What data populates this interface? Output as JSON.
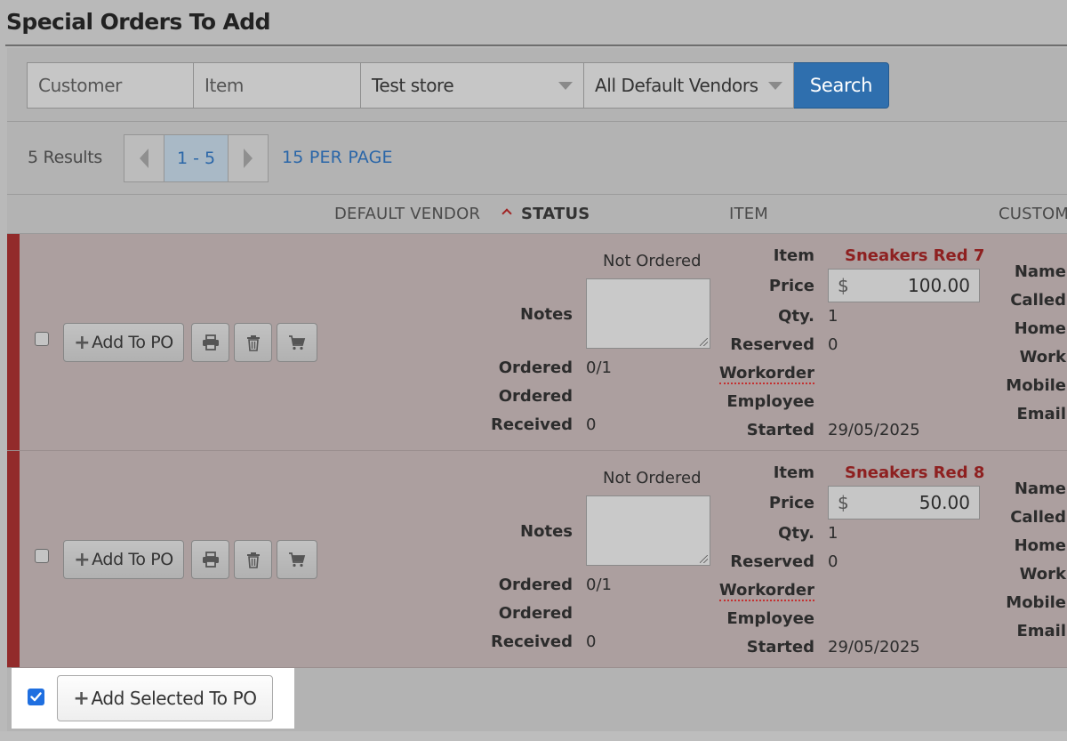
{
  "page": {
    "title": "Special Orders To Add"
  },
  "search": {
    "customer_placeholder": "Customer",
    "item_placeholder": "Item",
    "store_selected": "Test store",
    "vendor_selected": "All Default Vendors",
    "search_label": "Search"
  },
  "pagination": {
    "results": "5 Results",
    "current_range": "1 - 5",
    "per_page": "15 PER PAGE"
  },
  "columns": {
    "default_vendor": "DEFAULT VENDOR",
    "status": "STATUS",
    "item": "ITEM",
    "customer": "CUSTOM"
  },
  "labels": {
    "add_to_po": "Add To PO",
    "notes": "Notes",
    "ordered": "Ordered",
    "received": "Received",
    "item": "Item",
    "price": "Price",
    "qty": "Qty.",
    "reserved": "Reserved",
    "workorder": "Workorder",
    "employee": "Employee",
    "started": "Started",
    "currency": "$",
    "name": "Name",
    "called": "Called",
    "home": "Home",
    "work": "Work",
    "mobile": "Mobile",
    "email": "Email"
  },
  "rows": [
    {
      "status": "Not Ordered",
      "ordered_count": "0/1",
      "received": "0",
      "item_name": "Sneakers Red 7",
      "price": "100.00",
      "qty": "1",
      "reserved": "0",
      "started": "29/05/2025"
    },
    {
      "status": "Not Ordered",
      "ordered_count": "0/1",
      "received": "0",
      "item_name": "Sneakers Red 8",
      "price": "50.00",
      "qty": "1",
      "reserved": "0",
      "started": "29/05/2025"
    }
  ],
  "footer": {
    "add_selected_label": "Add Selected To PO"
  },
  "colors": {
    "accent_blue": "#2f6fae",
    "row_accent": "#922b2b",
    "item_link": "#8e2020",
    "checkbox_checked": "#1f6fe0"
  },
  "icons": [
    "plus-icon",
    "printer-icon",
    "trash-icon",
    "cart-icon",
    "chevron-left-icon",
    "chevron-right-icon",
    "caret-down-icon",
    "sort-up-icon",
    "check-icon"
  ]
}
